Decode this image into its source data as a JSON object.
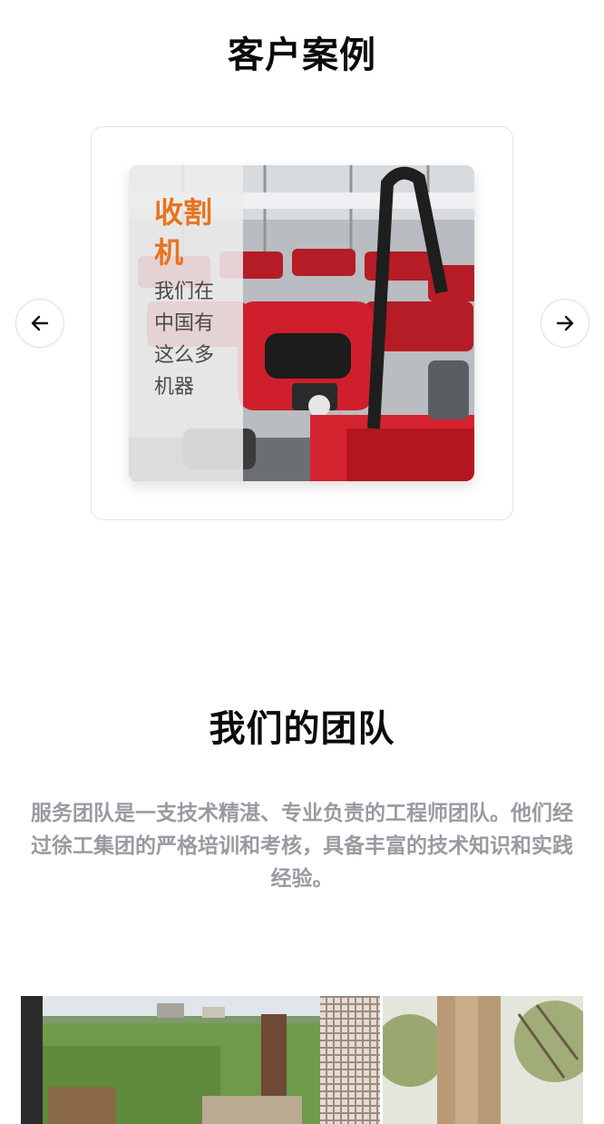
{
  "cases": {
    "title": "客户案例",
    "slide": {
      "heading": "收割机",
      "description": "我们在中国有这么多机器"
    },
    "prev_icon": "arrow-left-icon",
    "next_icon": "arrow-right-icon"
  },
  "team": {
    "title": "我们的团队",
    "description": "服务团队是一支技术精湛、专业负责的工程师团队。他们经过徐工集团的严格培训和考核，具备丰富的技术知识和实践经验。"
  },
  "colors": {
    "accent": "#e8731f",
    "title": "#0b0b0b",
    "muted_text": "#9a9aa2",
    "tractor_red": "#c8102e"
  }
}
